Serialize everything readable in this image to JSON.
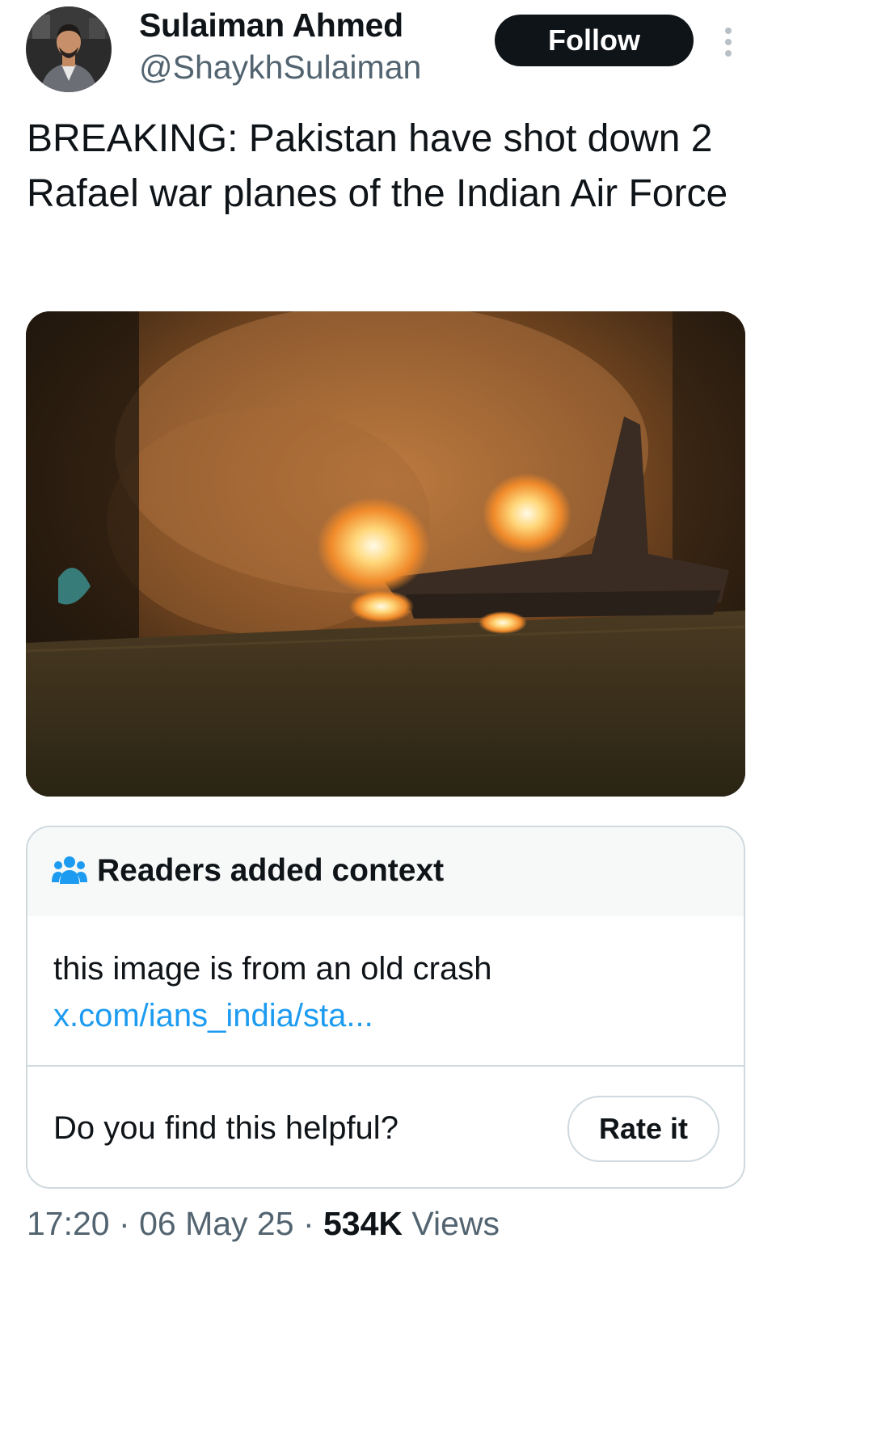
{
  "author": {
    "display_name": "Sulaiman Ahmed",
    "handle": "@ShaykhSulaiman",
    "avatar_icon": "profile-photo"
  },
  "actions": {
    "follow_label": "Follow",
    "more_icon": "more-vertical-icon"
  },
  "tweet": {
    "text": "BREAKING: Pakistan have shot down 2 Rafael war planes of the Indian Air Force",
    "media_icon": "burning-jet-photo"
  },
  "note": {
    "title": "Readers added context",
    "icon": "people-icon",
    "body_text": "this image is from an old crash ",
    "link_text": "x.com/ians_india/sta...",
    "helpful_question": "Do you find this helpful?",
    "rate_label": "Rate it"
  },
  "meta": {
    "time": "17:20",
    "separator": "·",
    "date": "06 May 25",
    "views_count": "534K",
    "views_label": "Views"
  },
  "colors": {
    "text_primary": "#0f1419",
    "text_secondary": "#536471",
    "link": "#1d9bf0",
    "border": "#cfd9de",
    "note_header_bg": "#f7f9f9",
    "follow_bg": "#0f1419"
  }
}
